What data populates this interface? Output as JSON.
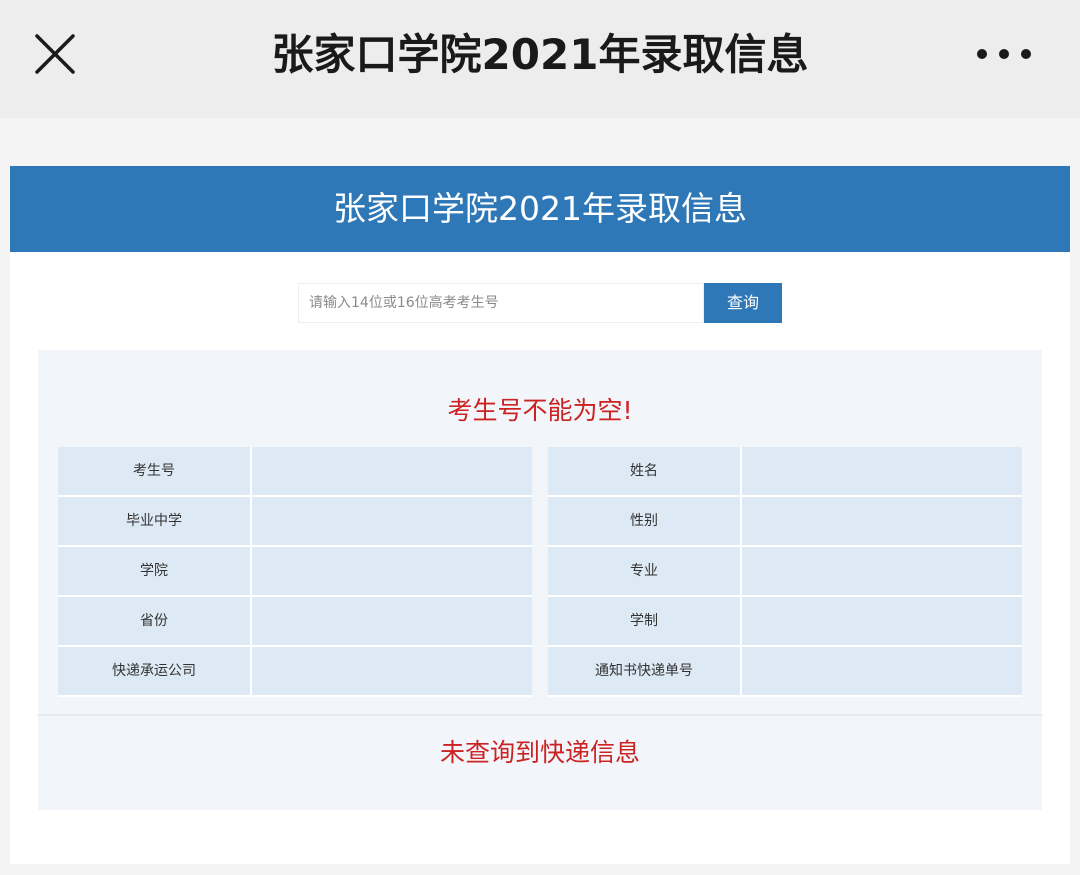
{
  "app_bar": {
    "title": "张家口学院2021年录取信息",
    "close_icon": "close-icon",
    "more_icon": "more-dots-icon"
  },
  "card": {
    "header_title": "张家口学院2021年录取信息"
  },
  "search": {
    "placeholder": "请输入14位或16位高考考生号",
    "value": "",
    "button_label": "查询"
  },
  "result": {
    "error_message": "考生号不能为空!",
    "left_fields": [
      {
        "label": "考生号",
        "value": ""
      },
      {
        "label": "毕业中学",
        "value": ""
      },
      {
        "label": "学院",
        "value": ""
      },
      {
        "label": "省份",
        "value": ""
      },
      {
        "label": "快递承运公司",
        "value": ""
      }
    ],
    "right_fields": [
      {
        "label": "姓名",
        "value": ""
      },
      {
        "label": "性别",
        "value": ""
      },
      {
        "label": "专业",
        "value": ""
      },
      {
        "label": "学制",
        "value": ""
      },
      {
        "label": "通知书快递单号",
        "value": ""
      }
    ],
    "express_message": "未查询到快递信息"
  },
  "colors": {
    "brand_blue": "#2f78b7",
    "error_red": "#cc2222",
    "cell_bg": "#dde9f4"
  }
}
